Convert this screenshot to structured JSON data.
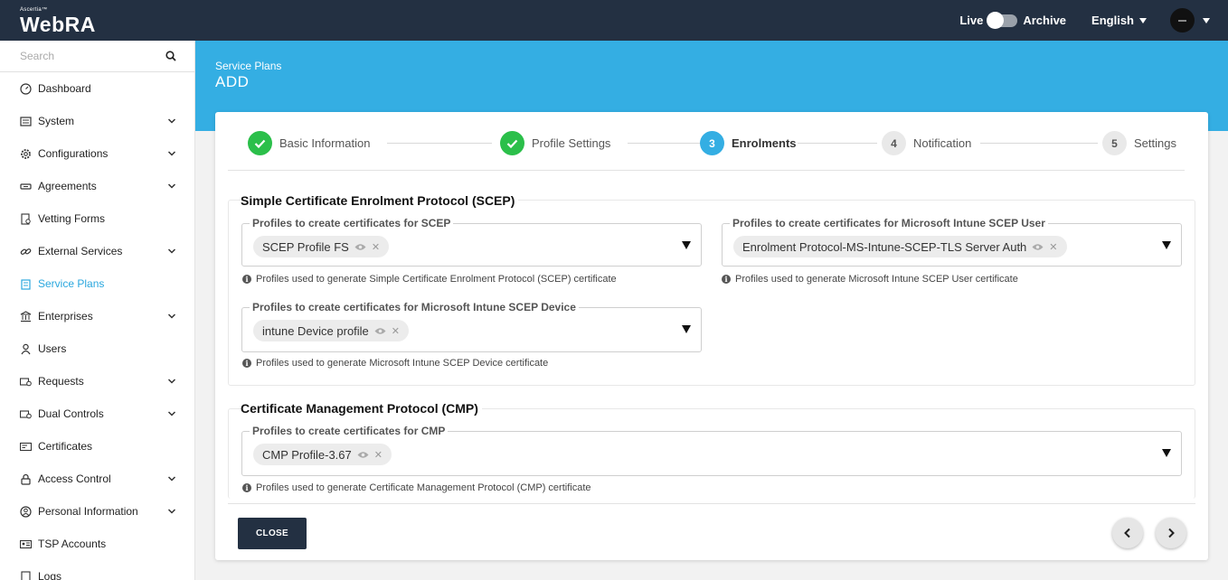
{
  "app": {
    "brand_small": "Ascertia™",
    "brand": "WebRA"
  },
  "topbar": {
    "live_label": "Live",
    "archive_label": "Archive",
    "language": "English"
  },
  "sidebar": {
    "search_placeholder": "Search",
    "items": [
      {
        "label": "Dashboard",
        "icon": "dashboard-icon",
        "expandable": false
      },
      {
        "label": "System",
        "icon": "system-icon",
        "expandable": true
      },
      {
        "label": "Configurations",
        "icon": "gear-icon",
        "expandable": true
      },
      {
        "label": "Agreements",
        "icon": "handshake-icon",
        "expandable": true
      },
      {
        "label": "Vetting Forms",
        "icon": "form-icon",
        "expandable": false
      },
      {
        "label": "External Services",
        "icon": "link-icon",
        "expandable": true
      },
      {
        "label": "Service Plans",
        "icon": "service-plans-icon",
        "expandable": false,
        "active": true
      },
      {
        "label": "Enterprises",
        "icon": "bank-icon",
        "expandable": true
      },
      {
        "label": "Users",
        "icon": "user-icon",
        "expandable": false
      },
      {
        "label": "Requests",
        "icon": "requests-icon",
        "expandable": true
      },
      {
        "label": "Dual Controls",
        "icon": "dual-controls-icon",
        "expandable": true
      },
      {
        "label": "Certificates",
        "icon": "certificate-icon",
        "expandable": false
      },
      {
        "label": "Access Control",
        "icon": "lock-icon",
        "expandable": true
      },
      {
        "label": "Personal Information",
        "icon": "person-circle-icon",
        "expandable": true
      },
      {
        "label": "TSP Accounts",
        "icon": "id-card-icon",
        "expandable": false
      },
      {
        "label": "Logs",
        "icon": "logs-icon",
        "expandable": false
      }
    ]
  },
  "header": {
    "breadcrumb": "Service Plans",
    "title": "ADD"
  },
  "stepper": {
    "steps": [
      {
        "number": "",
        "label": "Basic Information",
        "state": "done"
      },
      {
        "number": "",
        "label": "Profile Settings",
        "state": "done"
      },
      {
        "number": "3",
        "label": "Enrolments",
        "state": "current"
      },
      {
        "number": "4",
        "label": "Notification",
        "state": "todo"
      },
      {
        "number": "5",
        "label": "Settings",
        "state": "todo"
      }
    ]
  },
  "scep": {
    "title": "Simple Certificate Enrolment Protocol (SCEP)",
    "scep_field": {
      "label": "Profiles to create certificates for SCEP",
      "chip": "SCEP Profile FS",
      "hint": "Profiles used to generate Simple Certificate Enrolment Protocol (SCEP) certificate"
    },
    "intune_user_field": {
      "label": "Profiles to create certificates for Microsoft Intune SCEP User",
      "chip": "Enrolment Protocol-MS-Intune-SCEP-TLS Server Auth",
      "hint": "Profiles used to generate Microsoft Intune SCEP User certificate"
    },
    "intune_device_field": {
      "label": "Profiles to create certificates for Microsoft Intune SCEP Device",
      "chip": "intune Device profile",
      "hint": "Profiles used to generate Microsoft Intune SCEP Device certificate"
    }
  },
  "cmp": {
    "title": "Certificate Management Protocol (CMP)",
    "cmp_field": {
      "label": "Profiles to create certificates for CMP",
      "chip": "CMP Profile-3.67",
      "hint": "Profiles used to generate Certificate Management Protocol (CMP) certificate"
    }
  },
  "footer": {
    "close_label": "CLOSE"
  },
  "colors": {
    "topbar": "#233042",
    "accent": "#34aee3",
    "done": "#2bbf4a"
  }
}
